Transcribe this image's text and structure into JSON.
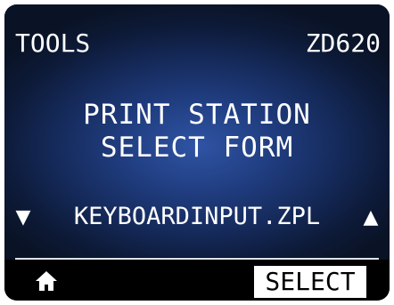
{
  "header": {
    "menu_title": "TOOLS",
    "model": "ZD620"
  },
  "main": {
    "title_lines": [
      "PRINT STATION",
      "SELECT FORM"
    ],
    "selected_item": "KEYBOARDINPUT.ZPL",
    "prev_arrow_icon": "triangle-down-icon",
    "next_arrow_icon": "triangle-up-icon",
    "arrow_down_glyph": "▼",
    "arrow_up_glyph": "▲"
  },
  "softkeys": {
    "home_icon": "home-icon",
    "select_label": "SELECT"
  },
  "colors": {
    "text": "#ffffff",
    "background_center": "#2f54a4",
    "background_edge": "#0a1326",
    "softkey_bar": "#000000",
    "softkey_highlight": "#ffffff"
  }
}
